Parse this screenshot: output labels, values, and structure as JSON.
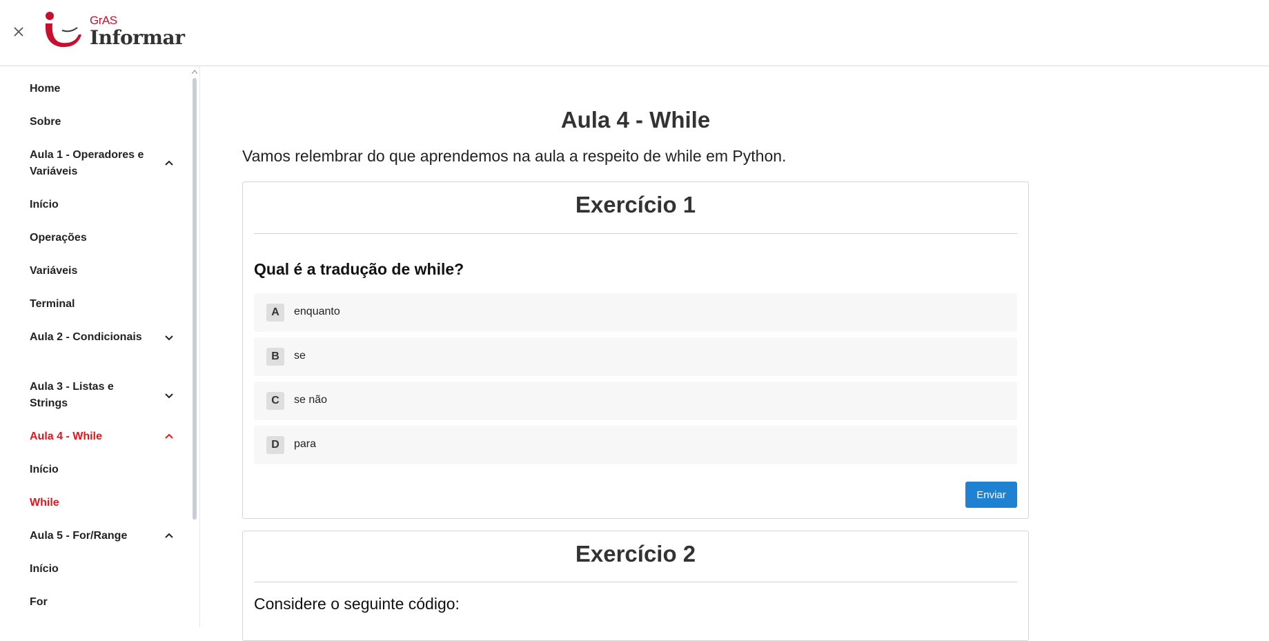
{
  "header": {
    "logo_small": "GrAS",
    "logo_big": "Informar",
    "close_icon": "close-icon"
  },
  "colors": {
    "accent_red": "#e8141b",
    "logo_red": "#c8102e",
    "button_blue": "#1f81d2",
    "option_bg": "#f7f7f7"
  },
  "sidebar": {
    "items": [
      {
        "label": "Home"
      },
      {
        "label": "Sobre"
      },
      {
        "label": "Aula 1 - Operadores e Variáveis",
        "chevron": "chevron-up-icon"
      },
      {
        "label": "Início"
      },
      {
        "label": "Operações"
      },
      {
        "label": "Variáveis"
      },
      {
        "label": "Terminal"
      },
      {
        "label": "Aula 2 - Condicionais",
        "chevron": "chevron-down-icon"
      },
      {
        "label": "Aula 3 - Listas e Strings",
        "chevron": "chevron-down-icon"
      },
      {
        "label": "Aula 4 - While",
        "chevron": "chevron-up-icon",
        "active": true
      },
      {
        "label": "Início"
      },
      {
        "label": "While",
        "active": true
      },
      {
        "label": "Aula 5 - For/Range",
        "chevron": "chevron-up-icon"
      },
      {
        "label": "Início"
      },
      {
        "label": "For"
      }
    ]
  },
  "main": {
    "title": "Aula 4 - While",
    "intro": "Vamos relembrar do que aprendemos na aula a respeito de while em Python.",
    "exercises": [
      {
        "title": "Exercício 1",
        "question": "Qual é a tradução de while?",
        "options": [
          {
            "letter": "A",
            "text": "enquanto"
          },
          {
            "letter": "B",
            "text": "se"
          },
          {
            "letter": "C",
            "text": "se não"
          },
          {
            "letter": "D",
            "text": "para"
          }
        ],
        "submit_label": "Enviar"
      },
      {
        "title": "Exercício 2",
        "text": "Considere o seguinte código:"
      }
    ]
  }
}
